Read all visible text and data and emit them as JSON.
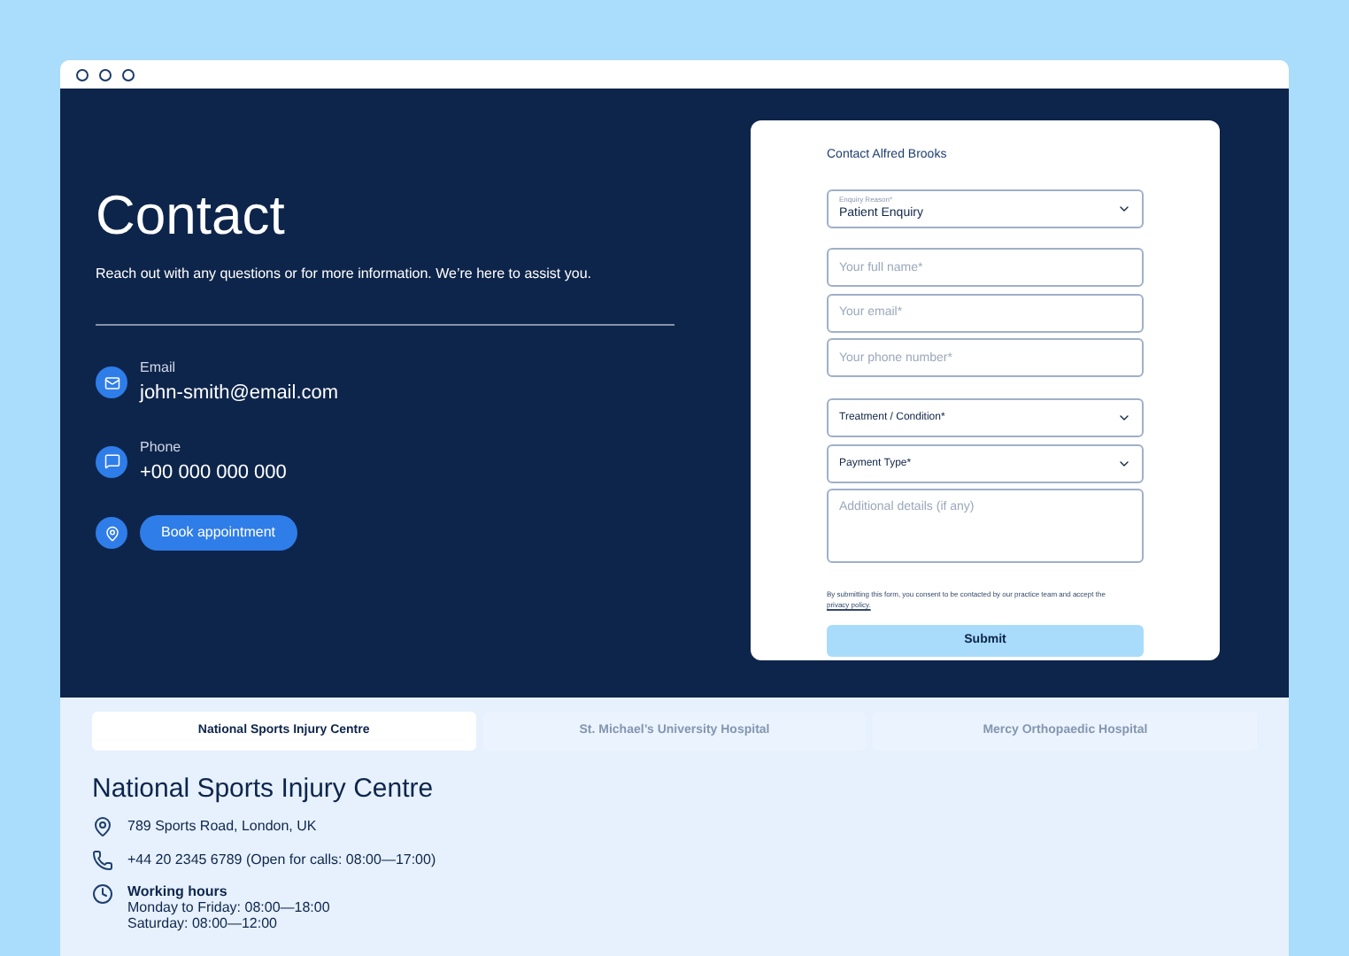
{
  "hero": {
    "title": "Contact",
    "subtitle": "Reach out with any questions or for more information. We’re here to assist you.",
    "contacts": [
      {
        "kind": "email",
        "label": "Email",
        "value": "john-smith@email.com"
      },
      {
        "kind": "phone",
        "label": "Phone",
        "value": "+00 000 000 000"
      }
    ],
    "book_button": "Book appointment"
  },
  "form": {
    "title": "Contact Alfred Brooks",
    "fields": [
      {
        "kind": "select",
        "label": "Enquiry Reason*",
        "value": "Patient Enquiry"
      },
      {
        "kind": "input",
        "placeholder": "Your full name*"
      },
      {
        "kind": "input",
        "placeholder": "Your email*"
      },
      {
        "kind": "input",
        "placeholder": "Your phone number*"
      },
      {
        "kind": "select",
        "placeholder": "Treatment / Condition*"
      },
      {
        "kind": "select",
        "placeholder": "Payment Type*"
      },
      {
        "kind": "textarea",
        "placeholder": "Additional details (if any)"
      }
    ],
    "consent": "By submitting this form, you consent to be contacted by our practice team and accept the",
    "consent_link": "privacy policy.",
    "submit": "Submit"
  },
  "tabs": [
    {
      "label": "National Sports Injury Centre",
      "selected": true
    },
    {
      "label": "St. Michael’s University Hospital",
      "selected": false
    },
    {
      "label": "Mercy Orthopaedic Hospital",
      "selected": false
    }
  ],
  "location": {
    "name": "National Sports Injury Centre",
    "address": "789 Sports Road, London, UK",
    "phone": "+44 20 2345 6789 (Open for calls: 08:00—17:00)",
    "hours_title": "Working hours",
    "hours": [
      "Monday to Friday: 08:00—18:00",
      "Saturday: 08:00—12:00"
    ]
  }
}
